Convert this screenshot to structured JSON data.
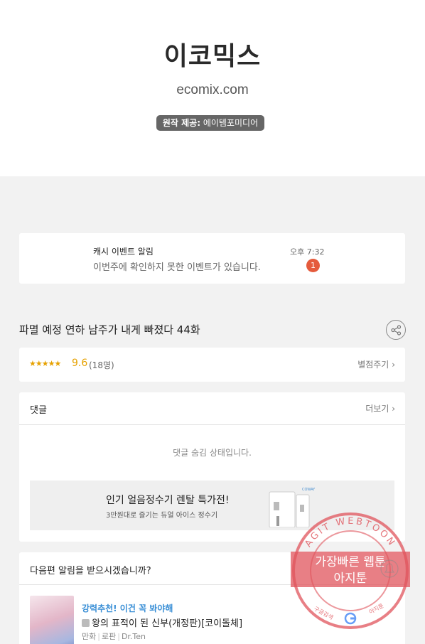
{
  "header": {
    "logo_text": "이코믹스",
    "site": "ecomix.com",
    "credit_label": "원작 제공:",
    "credit_value": "에이템포미디어"
  },
  "notification": {
    "title": "캐시 이벤트 알림",
    "message": "이번주에 확인하지 못한 이벤트가 있습니다.",
    "time": "오후 7:32",
    "badge": "1"
  },
  "episode": {
    "title": "파멸 예정 연하 남주가 내게 빠졌다 44화",
    "share_icon": "share-icon"
  },
  "rating": {
    "stars": "★★★★★",
    "score": "9.6",
    "count": "(18명)",
    "rate_button": "별점주기"
  },
  "comments": {
    "title": "댓글",
    "more": "더보기",
    "hidden_message": "댓글 숨김 상태입니다.",
    "ad": {
      "title": "인기 얼음정수기 렌탈 특가전!",
      "subtitle": "3만원대로 즐기는 듀얼 아이스 정수기",
      "brand": "COWAY"
    }
  },
  "next_episode": {
    "question": "다음편 알림을 받으시겠습니까?",
    "recommendation": {
      "tag": "강력추천! 이건 꼭 봐야해",
      "title": "왕의 표적이 된 신부(개정판)[코이돌체]",
      "category": "만화",
      "genre": "로판",
      "author": "Dr.Ten"
    }
  },
  "watermark": {
    "ring_text": "AGIT WEBTOON",
    "line1": "가장빠른 웹툰",
    "line2": "아지툰",
    "bottom_left": "구글검색",
    "bottom_right": "아지툰"
  },
  "colors": {
    "accent_gold": "#e6a100",
    "badge_red": "#e55b3c",
    "link_blue": "#3a8fd6",
    "stamp_red": "#e0545c"
  }
}
